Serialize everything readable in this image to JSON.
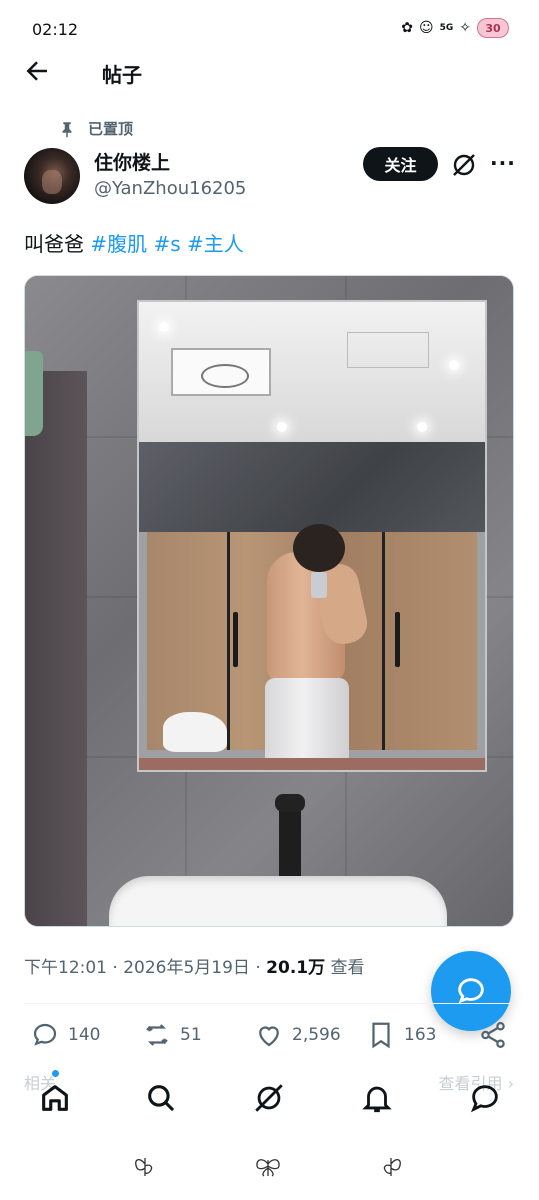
{
  "status_bar": {
    "time": "02:12",
    "network": "5G",
    "battery": "30"
  },
  "header": {
    "title": "帖子",
    "back_icon": "back-arrow-icon"
  },
  "post": {
    "pinned_label": "已置顶",
    "author_name": "住你楼上",
    "author_handle": "@YanZhou16205",
    "follow_label": "关注",
    "text": "叫爸爸",
    "hashtags": [
      "#腹肌",
      "#s",
      "#主人"
    ],
    "meta": {
      "time": "下午12:01",
      "date": "2026年5月19日",
      "views": "20.1万",
      "views_suffix": "查看"
    },
    "stats": {
      "replies": "140",
      "reposts": "51",
      "likes": "2,596",
      "bookmarks": "163"
    }
  },
  "related": {
    "left_label": "相关",
    "right_label": "查看引用"
  },
  "bottom_nav": [
    "home-icon",
    "search-icon",
    "grok-icon",
    "notifications-icon",
    "messages-icon"
  ],
  "colors": {
    "accent": "#1d9bf0",
    "text_primary": "#0f1419",
    "text_secondary": "#536471",
    "follow_bg": "#0f1419"
  }
}
